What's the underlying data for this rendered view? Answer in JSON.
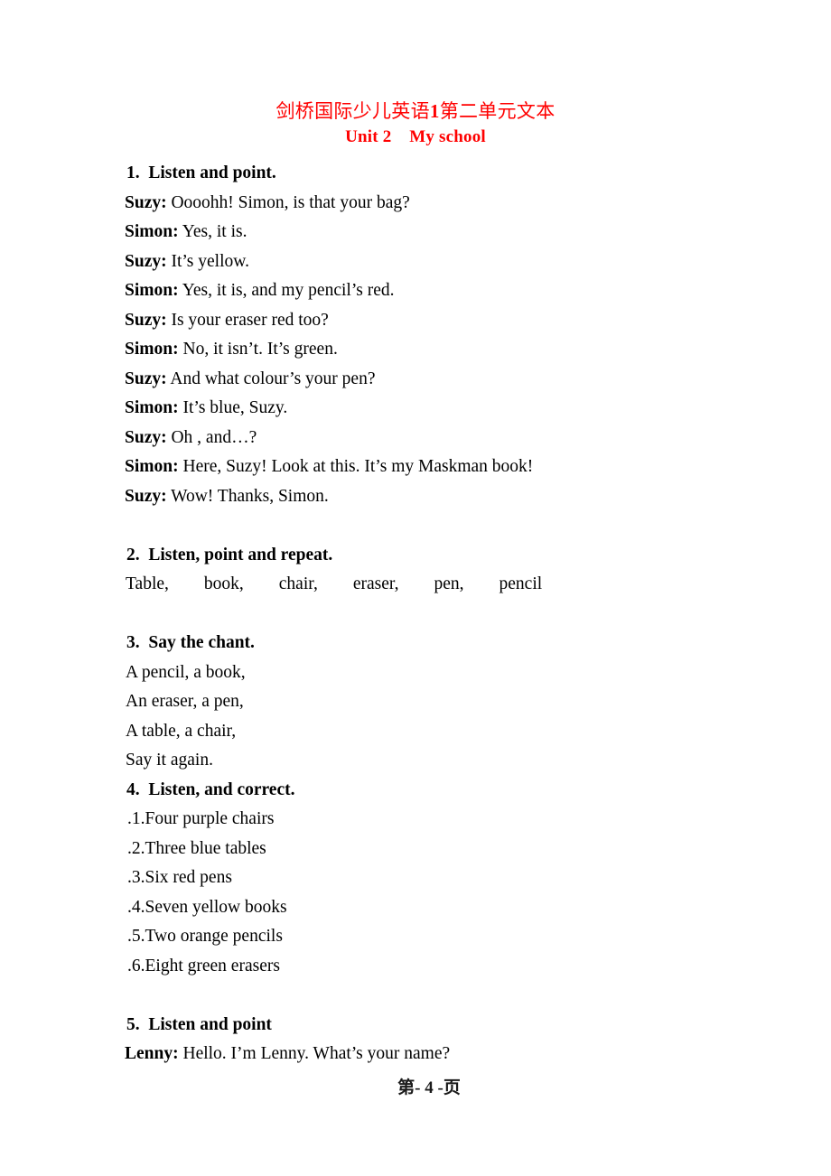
{
  "document": {
    "title_cn_part1": "剑桥国际少儿英语",
    "title_number": "1",
    "title_cn_part2": "第二单元文本",
    "unit_title": "Unit 2    My school",
    "title_color": "#FF0000",
    "body_color": "#000000",
    "page_background": "#FFFFFF"
  },
  "sections": {
    "s1": {
      "heading": "1.  Listen and point.",
      "dialogue": [
        {
          "speaker": "Suzy:",
          "text": " Oooohh! Simon, is that your bag?"
        },
        {
          "speaker": "Simon:",
          "text": " Yes, it is."
        },
        {
          "speaker": "Suzy:",
          "text": " It’s yellow."
        },
        {
          "speaker": "Simon:",
          "text": " Yes, it is, and my pencil’s red."
        },
        {
          "speaker": "Suzy:",
          "text": " Is your eraser red too?"
        },
        {
          "speaker": "Simon:",
          "text": " No, it isn’t. It’s green."
        },
        {
          "speaker": "Suzy:",
          "text": " And what colour’s your pen?"
        },
        {
          "speaker": "Simon:",
          "text": " It’s blue, Suzy."
        },
        {
          "speaker": "Suzy:",
          "text": " Oh , and…?"
        },
        {
          "speaker": "Simon:",
          "text": " Here, Suzy! Look at this. It’s my Maskman book!"
        },
        {
          "speaker": "Suzy:",
          "text": " Wow! Thanks, Simon."
        }
      ]
    },
    "s2": {
      "heading": "2.  Listen, point and repeat.",
      "words_line": "Table,        book,        chair,        eraser,        pen,        pencil",
      "words": [
        "Table,",
        "book,",
        "chair,",
        "eraser,",
        "pen,",
        "pencil"
      ]
    },
    "s3": {
      "heading": "3.  Say the chant.",
      "lines": [
        "A pencil, a book,",
        "An eraser, a pen,",
        "A table, a chair,",
        "Say it again."
      ]
    },
    "s4": {
      "heading": "4.  Listen, and correct.",
      "items": [
        ".1.Four purple chairs",
        ".2.Three blue tables",
        ".3.Six red pens",
        ".4.Seven yellow books",
        ".5.Two orange pencils",
        ".6.Eight green erasers"
      ]
    },
    "s5": {
      "heading": "5.  Listen and point",
      "dialogue": [
        {
          "speaker": "Lenny:",
          "text": " Hello. I’m Lenny. What’s your name?"
        }
      ]
    }
  },
  "footer": {
    "page_label": "第- 4 -页"
  }
}
